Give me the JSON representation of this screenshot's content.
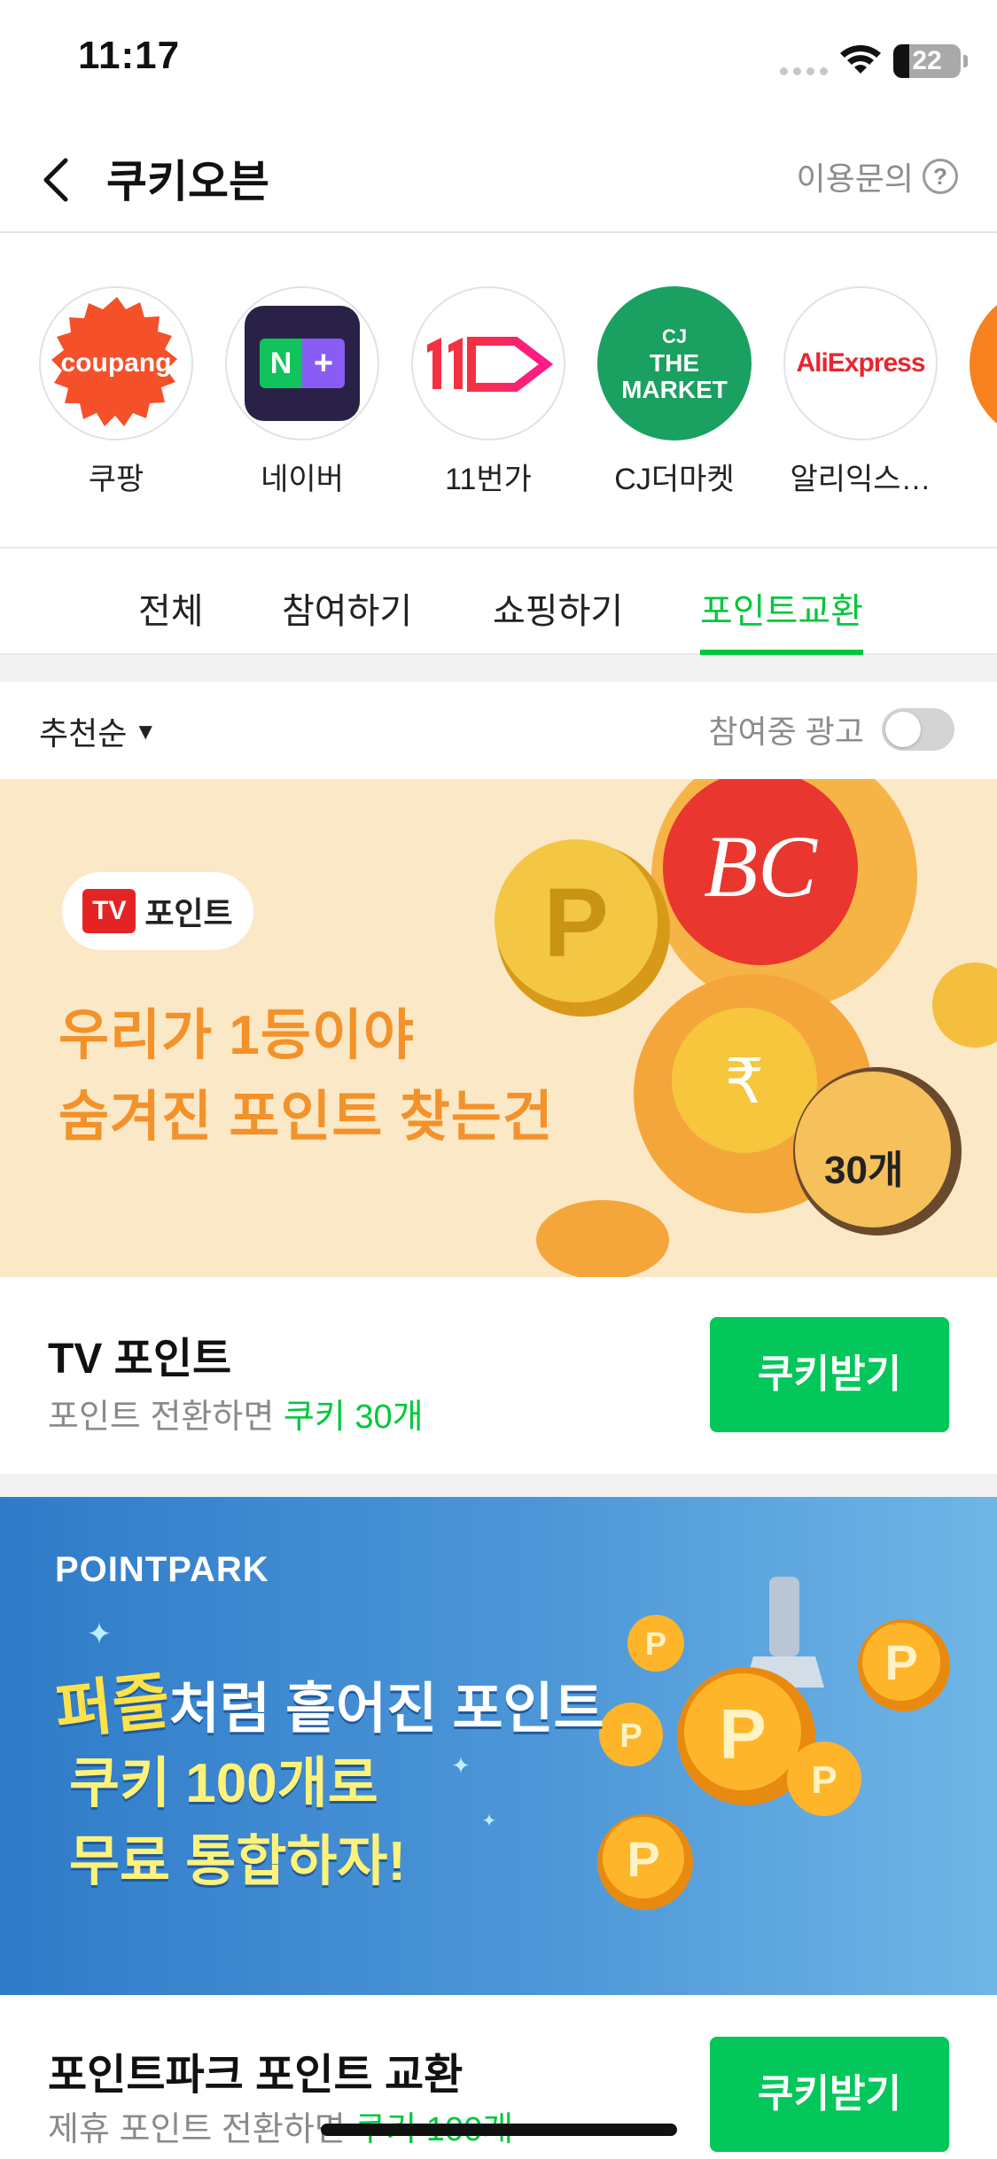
{
  "status_bar": {
    "time": "11:17",
    "battery": "22"
  },
  "header": {
    "title": "쿠키오븐",
    "help_label": "이용문의"
  },
  "partners": [
    {
      "name": "쿠팡",
      "logo_text": "coupang"
    },
    {
      "name": "네이버",
      "logo_text": "N+"
    },
    {
      "name": "11번가",
      "logo_text": "11"
    },
    {
      "name": "CJ더마켓",
      "logo_lines": [
        "CJ",
        "THE",
        "MARKET"
      ]
    },
    {
      "name": "알리익스…",
      "logo_text": "AliExpress"
    }
  ],
  "tabs": [
    {
      "label": "전체"
    },
    {
      "label": "참여하기"
    },
    {
      "label": "쇼핑하기"
    },
    {
      "label": "포인트교환",
      "active": true
    }
  ],
  "filter": {
    "sort_label": "추천순",
    "toggle_label": "참여중 광고",
    "toggle_on": false
  },
  "offers": [
    {
      "banner": {
        "brand_box": "TV",
        "brand_word": "포인트",
        "lines": [
          "우리가 1등이야",
          "숨겨진 포인트 찾는건"
        ],
        "badge": "30개"
      },
      "title": "TV 포인트",
      "subtitle_prefix": "포인트 전환하면 ",
      "subtitle_highlight": "쿠키 30개",
      "button": "쿠키받기"
    },
    {
      "banner": {
        "logo": "POINTPARK",
        "puzzle_word": "퍼즐",
        "line1_rest": "처럼 흩어진 포인트",
        "line2": "쿠키 100개로",
        "line3": "무료 통합하자!"
      },
      "title": "포인트파크 포인트 교환",
      "subtitle_prefix": "제휴 포인트 전환하면 ",
      "subtitle_highlight": "쿠키 100개",
      "button": "쿠키받기"
    }
  ],
  "colors": {
    "accent_green": "#00c73c",
    "button_green": "#03c75a",
    "coupang_red": "#f4502a",
    "cj_green": "#1aa061"
  }
}
